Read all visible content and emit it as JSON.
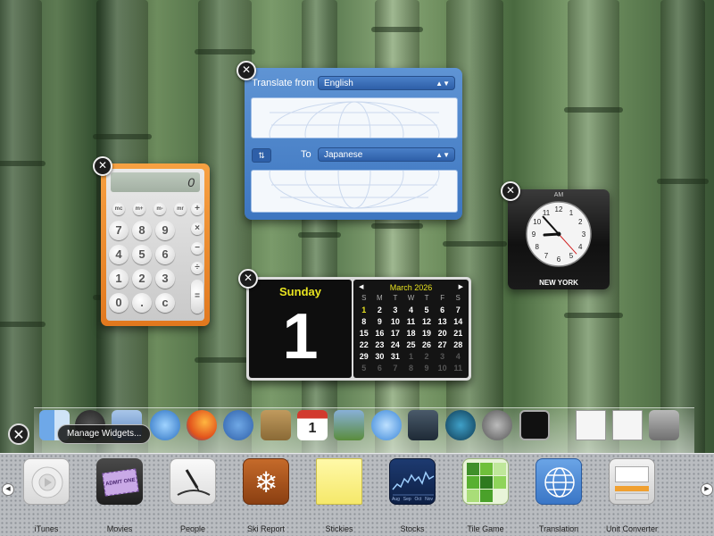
{
  "translate": {
    "from_label": "Translate from",
    "from_value": "English",
    "to_label": "To",
    "to_value": "Japanese",
    "swap_icon": "swap-icon"
  },
  "calculator": {
    "display": "0",
    "memory_keys": [
      "mc",
      "m+",
      "m-",
      "mr"
    ],
    "rows": [
      [
        "7",
        "8",
        "9"
      ],
      [
        "4",
        "5",
        "6"
      ],
      [
        "1",
        "2",
        "3"
      ],
      [
        "0",
        ".",
        "c"
      ]
    ],
    "op_keys": [
      "+",
      "×",
      "−",
      "÷",
      "="
    ]
  },
  "clock": {
    "period": "AM",
    "city": "NEW YORK",
    "hour": 8,
    "minute": 53,
    "second": 23,
    "numbers": [
      "12",
      "1",
      "2",
      "3",
      "4",
      "5",
      "6",
      "7",
      "8",
      "9",
      "10",
      "11"
    ]
  },
  "day_widget": {
    "day_name": "Sunday",
    "day_number": "1"
  },
  "calendar": {
    "month_label": "March 2026",
    "prev": "◀",
    "next": "▶",
    "weekdays": [
      "S",
      "M",
      "T",
      "W",
      "T",
      "F",
      "S"
    ],
    "days": [
      "1",
      "2",
      "3",
      "4",
      "5",
      "6",
      "7",
      "8",
      "9",
      "10",
      "11",
      "12",
      "13",
      "14",
      "15",
      "16",
      "17",
      "18",
      "19",
      "20",
      "21",
      "22",
      "23",
      "24",
      "25",
      "26",
      "27",
      "28",
      "29",
      "30",
      "31",
      "1",
      "2",
      "3",
      "4",
      "5",
      "6",
      "7",
      "8",
      "9",
      "10",
      "11"
    ]
  },
  "controls": {
    "close_all": "✕",
    "manage_label": "Manage Widgets...",
    "close_glyph": "✕"
  },
  "dock": {
    "icons": [
      "finder-icon",
      "clock-icon",
      "preview-icon",
      "safari-icon",
      "firefox-icon",
      "facetime-icon",
      "contacts-icon",
      "calendar-icon",
      "iphoto-icon",
      "itunes-icon",
      "mission-control-icon",
      "time-machine-icon",
      "system-preferences-icon",
      "terminal-icon",
      "document-icon",
      "document-icon",
      "trash-icon"
    ],
    "calendar_day": "1"
  },
  "widget_bar": {
    "items": [
      {
        "label": "iTunes",
        "icon": "itunes-widget-icon"
      },
      {
        "label": "Movies",
        "icon": "movies-ticket-icon"
      },
      {
        "label": "People",
        "icon": "people-phonebook-icon"
      },
      {
        "label": "Ski Report",
        "icon": "snowflake-icon"
      },
      {
        "label": "Stickies",
        "icon": "sticky-note-icon"
      },
      {
        "label": "Stocks",
        "icon": "stocks-chart-icon"
      },
      {
        "label": "Tile Game",
        "icon": "tile-game-icon"
      },
      {
        "label": "Translation",
        "icon": "globe-icon"
      },
      {
        "label": "Unit Converter",
        "icon": "unit-converter-icon"
      }
    ],
    "movies_ticket_text": "ADMIT ONE",
    "stocks_axis": [
      "Aug",
      "Sep",
      "Oct",
      "Nov"
    ],
    "left_arrow": "◀",
    "right_arrow": "▶"
  }
}
